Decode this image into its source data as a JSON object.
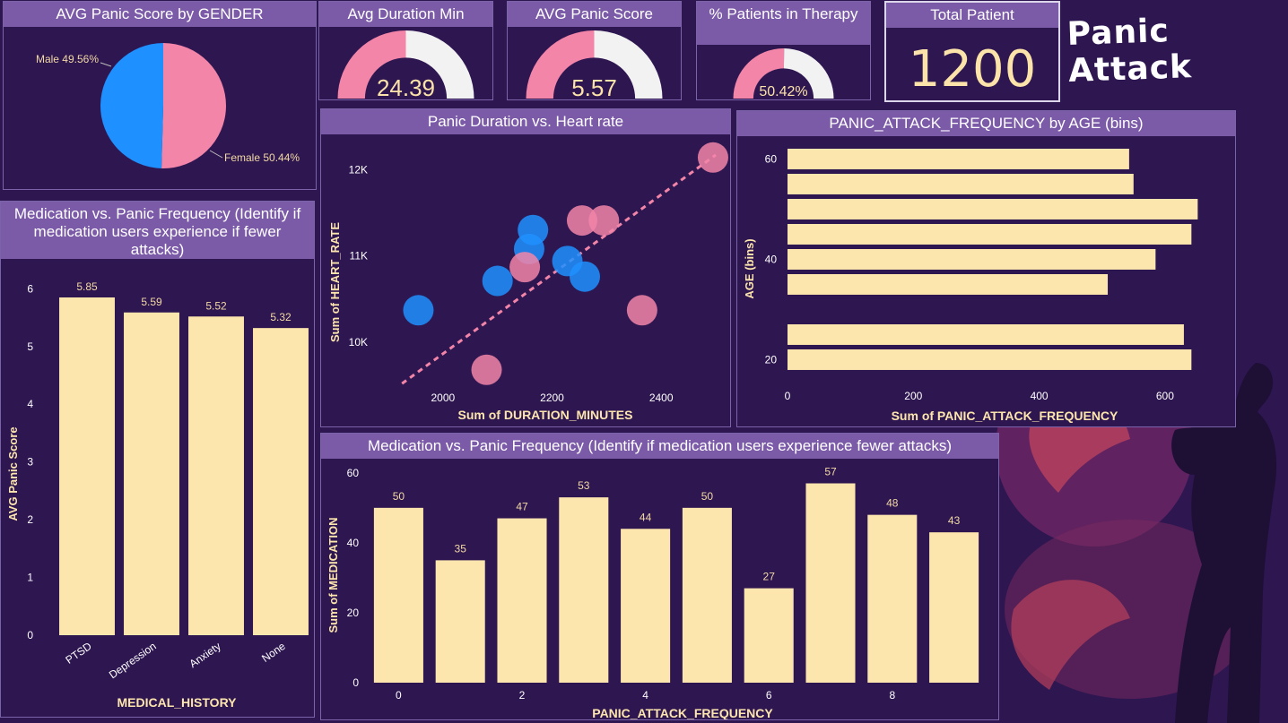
{
  "brand": {
    "title": "Panic Attack"
  },
  "colors": {
    "background": "#2e1651",
    "header": "#7b5aa8",
    "bar": "#fde6ad",
    "male": "#1e90ff",
    "female": "#f285a8",
    "gauge_bg": "#f2f2f2",
    "kpi_text": "#fbe3a9"
  },
  "kpis": {
    "avg_duration": {
      "title": "Avg Duration Min",
      "value": "24.39",
      "fraction": 0.5
    },
    "avg_panic": {
      "title": "AVG Panic Score",
      "value": "5.57",
      "fraction": 0.5
    },
    "therapy": {
      "title": "% Patients in Therapy",
      "value": "50.42%",
      "fraction": 0.5042
    },
    "total": {
      "title": "Total Patient",
      "value": "1200"
    }
  },
  "charts": {
    "gender": {
      "title": "AVG Panic Score by GENDER"
    },
    "med_history": {
      "title": "Medication vs. Panic Frequency (Identify if medication users experience if fewer attacks)"
    },
    "scatter": {
      "title": "Panic Duration vs. Heart rate"
    },
    "age": {
      "title": "PANIC_ATTACK_FREQUENCY by AGE (bins)"
    },
    "med_freq": {
      "title": "Medication vs. Panic Frequency (Identify if medication users experience fewer attacks)"
    }
  },
  "chart_data": [
    {
      "id": "gender",
      "type": "pie",
      "title": "AVG Panic Score by GENDER",
      "slices": [
        {
          "label": "Male",
          "label_text": "Male 49.56%",
          "value": 49.56,
          "color": "#1e90ff"
        },
        {
          "label": "Female",
          "label_text": "Female 50.44%",
          "value": 50.44,
          "color": "#f285a8"
        }
      ]
    },
    {
      "id": "med_history",
      "type": "bar",
      "title": "Medication vs. Panic Frequency (Identify if medication users experience if fewer attacks)",
      "xlabel": "MEDICAL_HISTORY",
      "ylabel": "AVG Panic Score",
      "categories": [
        "PTSD",
        "Depression",
        "Anxiety",
        "None"
      ],
      "values": [
        5.85,
        5.59,
        5.52,
        5.32
      ],
      "value_labels": [
        "5.85",
        "5.59",
        "5.52",
        "5.32"
      ],
      "ylim": [
        0,
        6.3
      ],
      "yticks": [
        0,
        1,
        2,
        3,
        4,
        5,
        6
      ]
    },
    {
      "id": "scatter",
      "type": "scatter",
      "title": "Panic Duration vs. Heart rate",
      "xlabel": "Sum of DURATION_MINUTES",
      "ylabel": "Sum of HEART_RATE",
      "xlim": [
        1900,
        2500
      ],
      "ylim": [
        9480,
        12200
      ],
      "xticks": [
        2000,
        2200,
        2400
      ],
      "yticks": [
        {
          "v": 10000,
          "label": "10K"
        },
        {
          "v": 11000,
          "label": "11K"
        },
        {
          "v": 12000,
          "label": "12K"
        }
      ],
      "trend": [
        {
          "x": 1925,
          "y": 9520
        },
        {
          "x": 2500,
          "y": 12170
        }
      ],
      "points": [
        {
          "x": 1955,
          "y": 10370,
          "g": "male"
        },
        {
          "x": 2100,
          "y": 10710,
          "g": "male"
        },
        {
          "x": 2158,
          "y": 11080,
          "g": "male"
        },
        {
          "x": 2165,
          "y": 11300,
          "g": "male"
        },
        {
          "x": 2228,
          "y": 10940,
          "g": "male"
        },
        {
          "x": 2260,
          "y": 10760,
          "g": "male"
        },
        {
          "x": 2150,
          "y": 10870,
          "g": "female"
        },
        {
          "x": 2255,
          "y": 11410,
          "g": "female"
        },
        {
          "x": 2295,
          "y": 11410,
          "g": "female"
        },
        {
          "x": 2080,
          "y": 9680,
          "g": "female"
        },
        {
          "x": 2365,
          "y": 10370,
          "g": "female"
        },
        {
          "x": 2495,
          "y": 12140,
          "g": "female"
        }
      ]
    },
    {
      "id": "age",
      "type": "bar",
      "orientation": "horizontal",
      "title": "PANIC_ATTACK_FREQUENCY by AGE (bins)",
      "xlabel": "Sum of PANIC_ATTACK_FREQUENCY",
      "ylabel": "AGE (bins)",
      "categories": [
        60,
        55,
        50,
        45,
        40,
        35,
        30,
        25,
        20
      ],
      "ytick_labels": [
        "60",
        "",
        "",
        "",
        "40",
        "",
        "",
        "",
        "20"
      ],
      "values": [
        543,
        550,
        652,
        642,
        585,
        509,
        630,
        642,
        0
      ],
      "bars": [
        {
          "bin": "60",
          "value": 543
        },
        {
          "bin": "55",
          "value": 550
        },
        {
          "bin": "50",
          "value": 652
        },
        {
          "bin": "45",
          "value": 642
        },
        {
          "bin": "40",
          "value": 585
        },
        {
          "bin": "35",
          "value": 509
        },
        {
          "bin": "25",
          "value": 630
        },
        {
          "bin": "20",
          "value": 642
        }
      ],
      "xlim": [
        0,
        690
      ],
      "xticks": [
        0,
        200,
        400,
        600
      ]
    },
    {
      "id": "med_freq",
      "type": "bar",
      "title": "Medication vs. Panic Frequency (Identify if medication users experience fewer attacks)",
      "xlabel": "PANIC_ATTACK_FREQUENCY",
      "ylabel": "Sum of MEDICATION",
      "categories": [
        0,
        1,
        2,
        3,
        4,
        5,
        6,
        7,
        8,
        9
      ],
      "values": [
        50,
        35,
        47,
        53,
        44,
        50,
        27,
        57,
        48,
        43
      ],
      "value_labels": [
        "50",
        "35",
        "47",
        "53",
        "44",
        "50",
        "27",
        "57",
        "48",
        "43"
      ],
      "xticks": [
        "0",
        "2",
        "4",
        "6",
        "8"
      ],
      "ylim": [
        0,
        62
      ],
      "yticks": [
        0,
        20,
        40,
        60
      ]
    }
  ]
}
